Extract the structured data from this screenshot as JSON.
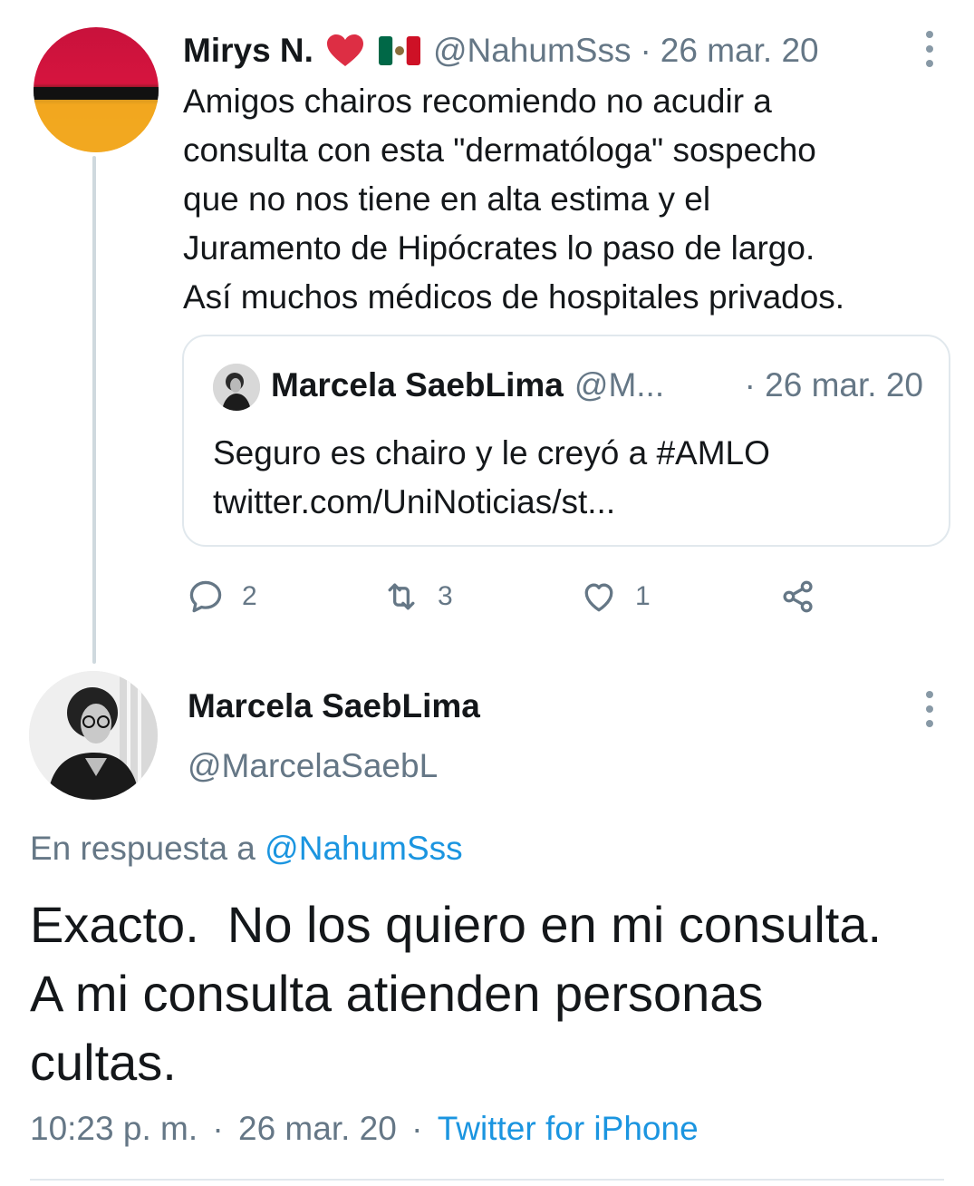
{
  "tweet1": {
    "name": "Mirys N.",
    "name_emojis": [
      "red-heart",
      "mexico-flag"
    ],
    "handle": "@NahumSss",
    "separator": "·",
    "date": "26 mar. 20",
    "lines": [
      "Amigos chairos recomiendo no acudir a",
      "consulta con esta \"dermatóloga\" sospecho",
      "que no nos tiene en alta estima y el",
      "Juramento de Hipócrates lo paso de largo.",
      "Así muchos médicos de hospitales privados."
    ],
    "quote": {
      "name": "Marcela SaebLima",
      "handle": "@M...",
      "date": "· 26 mar. 20",
      "lines": [
        "Seguro es chairo y le creyó a #AMLO",
        "twitter.com/UniNoticias/st..."
      ]
    },
    "actions": {
      "reply_count": "2",
      "retweet_count": "3",
      "like_count": "1"
    }
  },
  "tweet2": {
    "name": "Marcela SaebLima",
    "handle": "@MarcelaSaebL",
    "reply_prefix": "En respuesta a",
    "reply_handle": "@NahumSss",
    "lines": [
      "Exacto.  No los quiero en mi consulta.",
      "A mi consulta atienden personas",
      "cultas."
    ],
    "time": "10:23 p. m.",
    "date": "26 mar. 20",
    "separator": "·",
    "source": "Twitter for iPhone"
  },
  "colors": {
    "text": "#14171a",
    "muted": "#657786",
    "link": "#1b95e0",
    "border": "#e1e8ed"
  }
}
